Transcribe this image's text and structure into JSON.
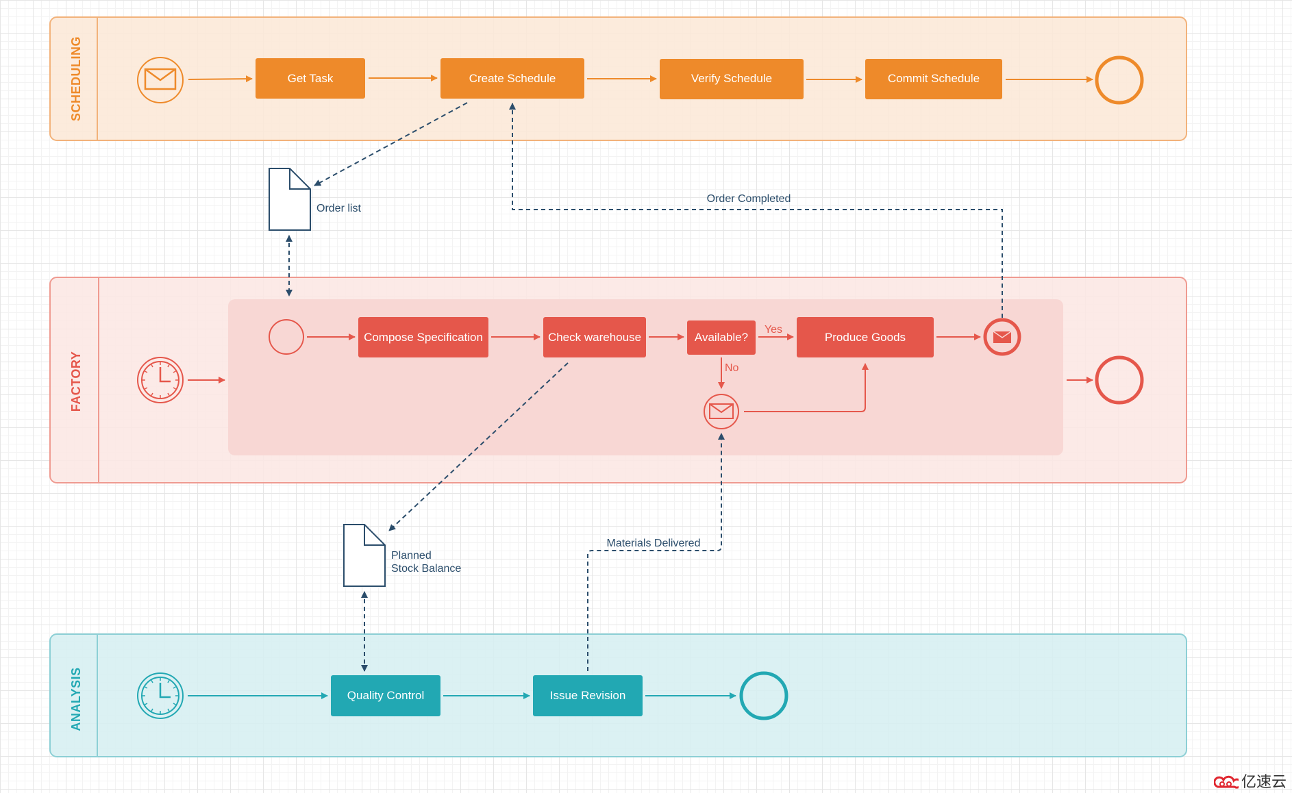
{
  "colors": {
    "scheduling": "#ee8a2a",
    "scheduling_bg": "#fce8d6",
    "factory": "#e5574b",
    "factory_bg": "#fbe6e3",
    "factory_pool_bg": "#f8d7d4",
    "analysis": "#22a8b3",
    "analysis_bg": "#d5eff1",
    "data_flow": "#2b4d6b"
  },
  "lanes": {
    "scheduling": "SCHEDULING",
    "factory": "FACTORY",
    "analysis": "ANALYSIS"
  },
  "tasks": {
    "get_task": "Get Task",
    "create_schedule": "Create Schedule",
    "verify_schedule": "Verify Schedule",
    "commit_schedule": "Commit Schedule",
    "compose_specification": "Compose Specification",
    "check_warehouse": "Check warehouse",
    "available": "Available?",
    "produce_goods": "Produce Goods",
    "quality_control": "Quality Control",
    "issue_revision": "Issue Revision"
  },
  "labels": {
    "yes": "Yes",
    "no": "No",
    "order_completed": "Order Completed",
    "materials_delivered": "Materials Delivered"
  },
  "documents": {
    "order_list": "Order list",
    "planned_stock_line1": "Planned",
    "planned_stock_line2": "Stock Balance"
  },
  "events": {
    "scheduling_start": "message-start-icon",
    "scheduling_end": "end-event-icon",
    "factory_start": "timer-start-icon",
    "factory_sub_start": "start-event-icon",
    "factory_message_catch": "message-intermediate-icon",
    "factory_message_throw": "message-end-icon",
    "factory_end": "end-event-icon",
    "analysis_start": "timer-start-icon",
    "analysis_end": "end-event-icon"
  },
  "watermark": "亿速云"
}
